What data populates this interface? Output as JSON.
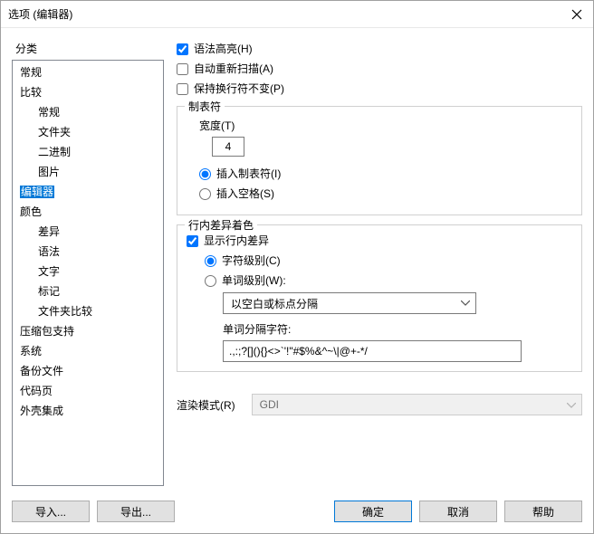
{
  "window": {
    "title": "选项 (编辑器)"
  },
  "sidebar": {
    "header": "分类",
    "items": [
      {
        "label": "常规",
        "level": 1
      },
      {
        "label": "比较",
        "level": 1
      },
      {
        "label": "常规",
        "level": 2
      },
      {
        "label": "文件夹",
        "level": 2
      },
      {
        "label": "二进制",
        "level": 2
      },
      {
        "label": "图片",
        "level": 2
      },
      {
        "label": "编辑器",
        "level": 1,
        "selected": true
      },
      {
        "label": "颜色",
        "level": 1
      },
      {
        "label": "差异",
        "level": 2
      },
      {
        "label": "语法",
        "level": 2
      },
      {
        "label": "文字",
        "level": 2
      },
      {
        "label": "标记",
        "level": 2
      },
      {
        "label": "文件夹比较",
        "level": 2
      },
      {
        "label": "压缩包支持",
        "level": 1
      },
      {
        "label": "系统",
        "level": 1
      },
      {
        "label": "备份文件",
        "level": 1
      },
      {
        "label": "代码页",
        "level": 1
      },
      {
        "label": "外壳集成",
        "level": 1
      }
    ]
  },
  "checks": {
    "syntax_highlight": "语法高亮(H)",
    "auto_rescan": "自动重新扫描(A)",
    "preserve_eol": "保持换行符不变(P)"
  },
  "tab_group": {
    "title": "制表符",
    "width_label": "宽度(T)",
    "width_value": "4",
    "insert_tabs": "插入制表符(I)",
    "insert_spaces": "插入空格(S)"
  },
  "inline_group": {
    "title": "行内差异着色",
    "show_inline": "显示行内差异",
    "char_level": "字符级别(C)",
    "word_level": "单词级别(W):",
    "break_type": "以空白或标点分隔",
    "break_chars_label": "单词分隔字符:",
    "break_chars_value": ".,:;?[](){}<>`'!\"#$%&^~\\|@+-*/"
  },
  "render": {
    "label": "渲染模式(R)",
    "value": "GDI"
  },
  "footer": {
    "import": "导入...",
    "export": "导出...",
    "ok": "确定",
    "cancel": "取消",
    "help": "帮助"
  }
}
